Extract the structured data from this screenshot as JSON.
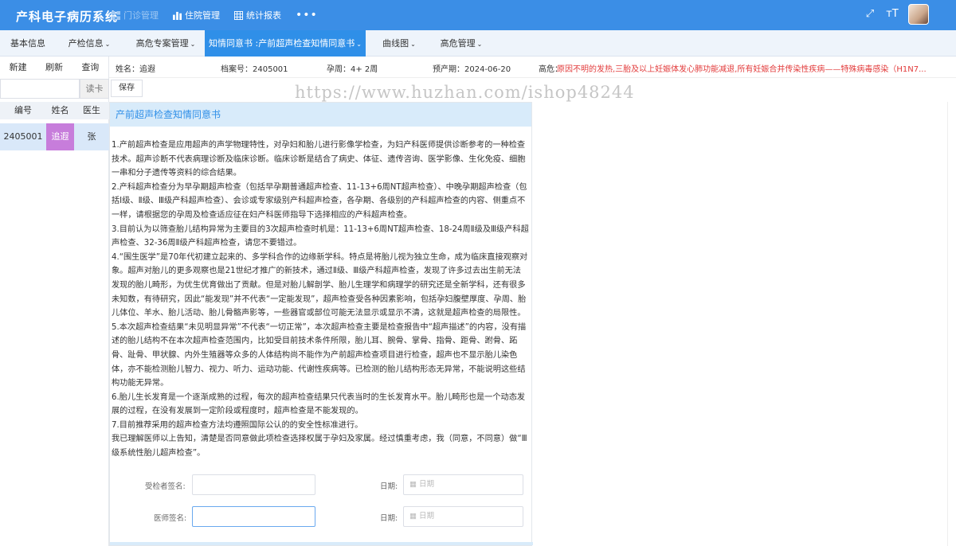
{
  "app": {
    "title": "产科电子病历系统"
  },
  "topnav": [
    {
      "label": "门诊管理",
      "icon": "grid-icon",
      "active": true
    },
    {
      "label": "住院管理",
      "icon": "bar-chart-icon",
      "active": false
    },
    {
      "label": "统计报表",
      "icon": "table-icon",
      "active": false
    }
  ],
  "topnav_more": "•••",
  "tools": {
    "fullscreen": "⤢",
    "font": "ᴛT"
  },
  "menubar": [
    {
      "label": "基本信息",
      "caret": ""
    },
    {
      "label": "产检信息",
      "caret": "⌄"
    },
    {
      "label": "高危专案管理",
      "caret": "⌄"
    },
    {
      "label": "知情同意书 :产前超声检查知情同意书",
      "caret": "⌄"
    },
    {
      "label": "曲线图",
      "caret": "⌄"
    },
    {
      "label": "高危管理",
      "caret": "⌄"
    }
  ],
  "left": {
    "actions": [
      "新建",
      "刷新",
      "查询"
    ],
    "search_button": "读卡",
    "columns": [
      "编号",
      "姓名",
      "医生"
    ],
    "rows": [
      {
        "id": "2405001",
        "name": "追遐",
        "doctor": "张"
      }
    ]
  },
  "patient": {
    "name": "姓名：追遐",
    "file_no": "档案号：2405001",
    "gestation": "孕周：4+ 2周",
    "due_date": "预产期：2024-06-20",
    "risk_label": "高危：",
    "risk_text": "原因不明的发热,三胎及以上妊娠体发心肺功能减退,所有妊娠合并传染性疾病——特殊病毒感染（H1N7..."
  },
  "save_label": "保存",
  "watermark": "https://www.huzhan.com/ishop48244",
  "document": {
    "title": "产前超声检查知情同意书",
    "paragraphs": [
      "1.产前超声检查是应用超声的声学物理特性，对孕妇和胎儿进行影像学检查，为妇产科医师提供诊断参考的一种检查技术。超声诊断不代表病理诊断及临床诊断。临床诊断是结合了病史、体征、遗传咨询、医学影像、生化免疫、细胞一串和分子遗传等资料的综合结果。",
      "2.产科超声检查分为早孕期超声检查（包括早孕期普通超声检查、11-13+6周NT超声检查）、中晚孕期超声检查（包括Ⅰ级、Ⅱ级、Ⅲ级产科超声检查）、会诊或专家级别产科超声检查，各孕期、各级别的产科超声检查的内容、侧重点不一样，请根据您的孕周及检查适应征在妇产科医师指导下选择相应的产科超声检查。",
      "3.目前认为以筛查胎儿结构异常为主要目的3次超声检查时机是：11-13+6周NT超声检查、18-24周Ⅱ级及Ⅲ级产科超声检查、32-36周Ⅱ级产科超声检查，请您不要错过。",
      "4.“围生医学”是70年代初建立起来的、多学科合作的边缘新学科。特点是将胎儿视为独立生命，成为临床直接观察对象。超声对胎儿的更多观察也是21世纪才推广的新技术，通过Ⅱ级、Ⅲ级产科超声检查，发现了许多过去出生前无法发现的胎儿畸形，为优生优育做出了贡献。但是对胎儿解剖学、胎儿生理学和病理学的研究还是全新学科，还有很多未知数，有待研究，因此“能发现”并不代表“一定能发现”，超声检查受各种因素影响，包括孕妇腹壁厚度、孕周、胎儿体位、羊水、胎儿活动、胎儿骨骼声影等，一些器官或部位可能无法显示或显示不清，这就是超声检查的局限性。",
      "5.本次超声检查结果“未见明显异常”不代表“一切正常”，本次超声检查主要是检查报告中“超声描述”的内容，没有描述的胎儿结构不在本次超声检查范围内，比如受目前技术条件所限，胎儿耳、腕骨、掌骨、指骨、距骨、跗骨、跖骨、趾骨、甲状腺、内外生殖器等众多的人体结构尚不能作为产前超声检查项目进行检查，超声也不显示胎儿染色体，亦不能检测胎儿智力、视力、听力、运动功能、代谢性疾病等。已检测的胎儿结构形态无异常，不能说明这些结构功能无异常。",
      "6.胎儿生长发育是一个逐渐成熟的过程，每次的超声检查结果只代表当时的生长发育水平。胎儿畸形也是一个动态发展的过程，在没有发展到一定阶段或程度时，超声检查是不能发现的。",
      "7.目前推荐采用的超声检查方法均遵照国际公认的的安全性标准进行。",
      "我已理解医师以上告知，清楚是否同意做此项检查选择权属于孕妇及家属。经过慎重考虑，我（同意，不同意）做“Ⅲ级系统性胎儿超声检查”。"
    ],
    "examinee_label": "受检者签名:",
    "doctor_label": "医师签名:",
    "date_label": "日期:",
    "date_placeholder": "日期",
    "calendar_icon": "▦"
  },
  "colors": {
    "header": "#3b8ee6",
    "active_tab": "#2f8fe8",
    "risk": "#e23b3b"
  }
}
